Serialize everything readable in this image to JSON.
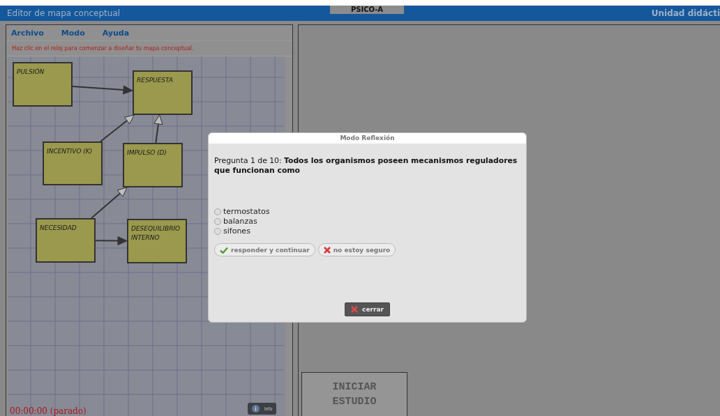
{
  "header": {
    "title": "Editor de mapa conceptual",
    "tab": "PSICO-A",
    "right_title": "Unidad didácti"
  },
  "menu": [
    {
      "label": "Archivo",
      "dropdown": true
    },
    {
      "label": "Modo",
      "dropdown": true
    },
    {
      "label": "Ayuda",
      "dropdown": false
    }
  ],
  "hint": "Haz clic en el reloj para comenzar a diseñar tu mapa conceptual.",
  "map": {
    "nodes": [
      {
        "label": "PULSIÓN"
      },
      {
        "label": "RESPUESTA"
      },
      {
        "label": "INCENTIVO (K)"
      },
      {
        "label": "IMPULSO (D)"
      },
      {
        "label": "NECESIDAD"
      },
      {
        "label": "DESEQUILIBRIO INTERNO"
      }
    ],
    "edges": [
      {
        "kind": "filled"
      },
      {
        "kind": "hollow"
      },
      {
        "kind": "hollow"
      },
      {
        "kind": "hollow"
      },
      {
        "kind": "filled"
      }
    ]
  },
  "timer": "00:00:00 (parado)",
  "info_button": "info",
  "start_button": "INICIAR ESTUDIO",
  "dialog": {
    "title": "Modo Reflexión",
    "question_prefix": "Pregunta 1 de 10:",
    "question": "Todos los organismos poseen mecanismos reguladores que funcionan como",
    "options": [
      {
        "label": "termostatos",
        "selected": false
      },
      {
        "label": "balanzas",
        "selected": false
      },
      {
        "label": "sifones",
        "selected": false
      }
    ],
    "answer_button": "responder y continuar",
    "unsure_button": "no estoy seguro",
    "close_button": "cerrar"
  }
}
